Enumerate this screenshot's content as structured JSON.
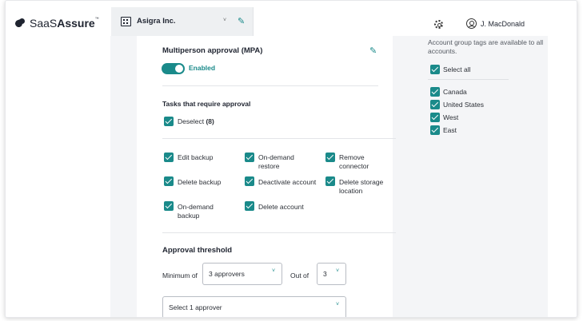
{
  "brand": {
    "name_light": "SaaS",
    "name_bold": "Assure",
    "trademark": "™"
  },
  "header": {
    "org_name": "Asigra Inc.",
    "org_caret": "˅",
    "user_name": "J. MacDonald"
  },
  "mpa": {
    "title": "Multiperson approval (MPA)",
    "toggle_label": "Enabled",
    "toggle_on": true,
    "tasks_title": "Tasks that require approval",
    "deselect_label": "Deselect",
    "deselect_count": "(8)",
    "tasks": [
      {
        "label": "Edit backup",
        "checked": true
      },
      {
        "label": "On-demand restore",
        "checked": true
      },
      {
        "label": "Remove connector",
        "checked": true
      },
      {
        "label": "Delete backup",
        "checked": true
      },
      {
        "label": "Deactivate account",
        "checked": true
      },
      {
        "label": "Delete storage location",
        "checked": true
      },
      {
        "label": "On-demand backup",
        "checked": true
      },
      {
        "label": "Delete account",
        "checked": true
      }
    ]
  },
  "threshold": {
    "title": "Approval threshold",
    "minimum_label": "Minimum of",
    "minimum_value": "3 approvers",
    "out_of_label": "Out of",
    "out_of_value": "3",
    "approver_placeholder": "Select 1 approver",
    "caret": "˅"
  },
  "tags": {
    "intro": "Account group tags are available to all accounts.",
    "select_all": "Select all",
    "items": [
      {
        "label": "Canada",
        "checked": true
      },
      {
        "label": "United States",
        "checked": true
      },
      {
        "label": "West",
        "checked": true
      },
      {
        "label": "East",
        "checked": true
      }
    ]
  },
  "colors": {
    "accent": "#1a8a8a",
    "background": "#f4f5f7"
  },
  "icons": [
    "logo-icon",
    "building-icon",
    "edit-icon",
    "gear-icon",
    "user-icon",
    "check-icon",
    "chevron-down-icon"
  ]
}
